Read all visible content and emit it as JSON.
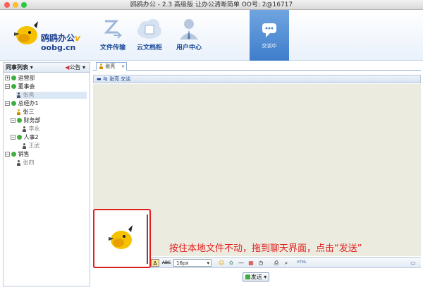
{
  "window": {
    "title": "鸥鸥办公 - 2.3 高级版 让办公清晰简单 OO号: 2@16717"
  },
  "logo": {
    "name": "鸥鸥办公",
    "version": "V",
    "url": "oobg.cn"
  },
  "nav": {
    "file": "文件传输",
    "cloud": "云文档柜",
    "user": "用户中心",
    "chat": "交谈中"
  },
  "sidebar": {
    "tab": "同事列表",
    "notice": "公告"
  },
  "tree": [
    {
      "label": "运营部"
    },
    {
      "label": "董事会"
    },
    {
      "label": "张亮"
    },
    {
      "label": "总经办1"
    },
    {
      "label": "张三"
    },
    {
      "label": "财务部"
    },
    {
      "label": "李永"
    },
    {
      "label": "人事2"
    },
    {
      "label": "王武"
    },
    {
      "label": "销售"
    },
    {
      "label": "张四"
    }
  ],
  "chat": {
    "tab": "张亮",
    "header": "与 张亮 交谈",
    "font_size": "16px",
    "instruction": "按住本地文件不动，拖到聊天界面，点击“发送”",
    "send": "发送"
  },
  "toolbar": {
    "bold": "B",
    "italic": "I",
    "underline": "U",
    "font": "A",
    "strike": "ABC",
    "html": "HTML"
  },
  "colors": {
    "accent": "#1b3f8c",
    "active_nav": "#4a88d4",
    "highlight": "#e02020",
    "chat_bg": "#ecebdf"
  }
}
